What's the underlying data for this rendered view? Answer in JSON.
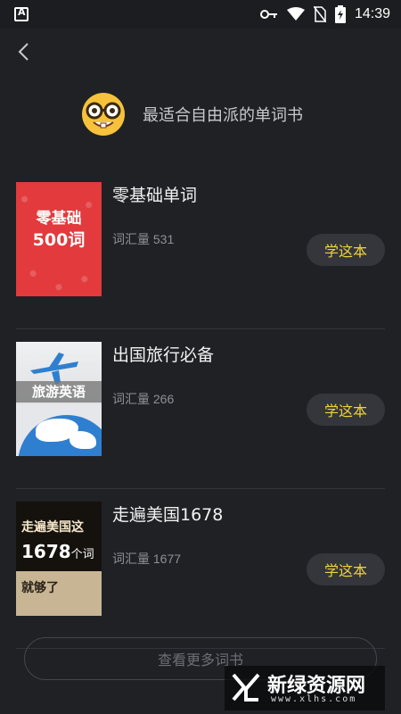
{
  "status_bar": {
    "time": "14:39"
  },
  "header": {
    "title": "最适合自由派的单词书"
  },
  "books": [
    {
      "name": "零基础单词",
      "count": "词汇量 531",
      "button": "学这本",
      "cover_lines": [
        "零基础",
        "500词"
      ]
    },
    {
      "name": "出国旅行必备",
      "count": "词汇量 266",
      "button": "学这本",
      "cover_lines": [
        "旅游英语"
      ]
    },
    {
      "name": "走遍美国1678",
      "count": "词汇量 1677",
      "button": "学这本",
      "cover_lines": [
        "走遍美国这",
        "1678",
        "个词",
        "就够了"
      ]
    }
  ],
  "more_button": "查看更多词书",
  "watermark": {
    "text": "新绿资源网",
    "url": "www.xlhs.com"
  },
  "colors": {
    "background": "#1f2125",
    "button_text": "#f0d23c",
    "button_bg": "#34363b"
  },
  "icons": [
    "back-arrow-icon",
    "key-icon",
    "wifi-icon",
    "no-sim-icon",
    "battery-charging-icon",
    "nerd-face-emoji-icon"
  ]
}
